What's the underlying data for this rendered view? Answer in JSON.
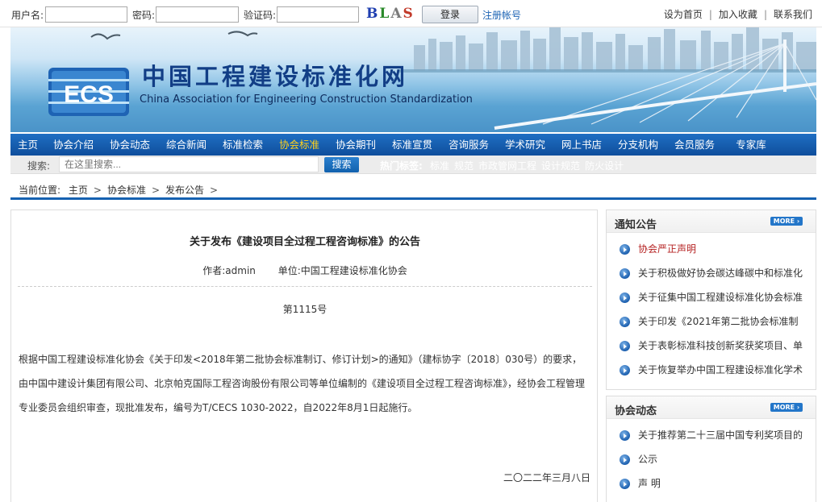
{
  "login": {
    "username_label": "用户名:",
    "password_label": "密码:",
    "captcha_label": "验证码:",
    "captcha_text": [
      "B",
      "L",
      "A",
      "S"
    ],
    "login_button": "登录",
    "register_link": "注册帐号"
  },
  "toplinks": [
    "设为首页",
    "加入收藏",
    "联系我们"
  ],
  "banner": {
    "title": "中国工程建设标准化网",
    "subtitle": "China Association for Engineering Construction Standardization",
    "logo_text": "ECS"
  },
  "nav": {
    "items": [
      "主页",
      "协会介绍",
      "协会动态",
      "综合新闻",
      "标准检索",
      "协会标准",
      "协会期刊",
      "标准宣贯",
      "咨询服务",
      "学术研究",
      "网上书店",
      "分支机构",
      "会员服务",
      "专家库"
    ],
    "active_index": 5
  },
  "search": {
    "label": "搜索:",
    "placeholder": "在这里搜索...",
    "button": "搜索",
    "hot_label": "热门标签:",
    "hot_tags": [
      "标准",
      "规范",
      "市政管网工程",
      "设计规范",
      "防火设计"
    ]
  },
  "breadcrumb": {
    "prefix": "当前位置:",
    "items": [
      "主页",
      "协会标准",
      "发布公告"
    ]
  },
  "article": {
    "title": "关于发布《建设项目全过程工程咨询标准》的公告",
    "author": "作者:admin",
    "unit": "单位:中国工程建设标准化协会",
    "number": "第1115号",
    "body_lines": [
      "根据中国工程建设标准化协会《关于印发<2018年第二批协会标准制订、修订计划>的通知》（建标协字〔2018〕030号）的要求，",
      "由中国中建设计集团有限公司、北京帕克国际工程咨询股份有限公司等单位编制的《建设项目全过程工程咨询标准》，经协会工程管理",
      "专业委员会组织审查，现批准发布，编号为T/CECS 1030-2022，自2022年8月1日起施行。"
    ],
    "date": "二〇二二年三月八日"
  },
  "sidebar": {
    "more_label": "MORE",
    "notices": {
      "title": "通知公告",
      "items": [
        "协会严正声明",
        "关于积极做好协会碳达峰碳中和标准化",
        "关于征集中国工程建设标准化协会标准",
        "关于印发《2021年第二批协会标准制",
        "关于表彰标准科技创新奖获奖项目、单",
        "关于恢复举办中国工程建设标准化学术"
      ]
    },
    "news": {
      "title": "协会动态",
      "items": [
        "关于推荐第二十三届中国专利奖项目的",
        "公示",
        "声 明"
      ]
    }
  },
  "colors": {
    "nav_bg": "#1561b1",
    "nav_active": "#ffd11a",
    "title_blue": "#123e86",
    "link_blue": "#1a62b3",
    "notice_red": "#b52121"
  }
}
